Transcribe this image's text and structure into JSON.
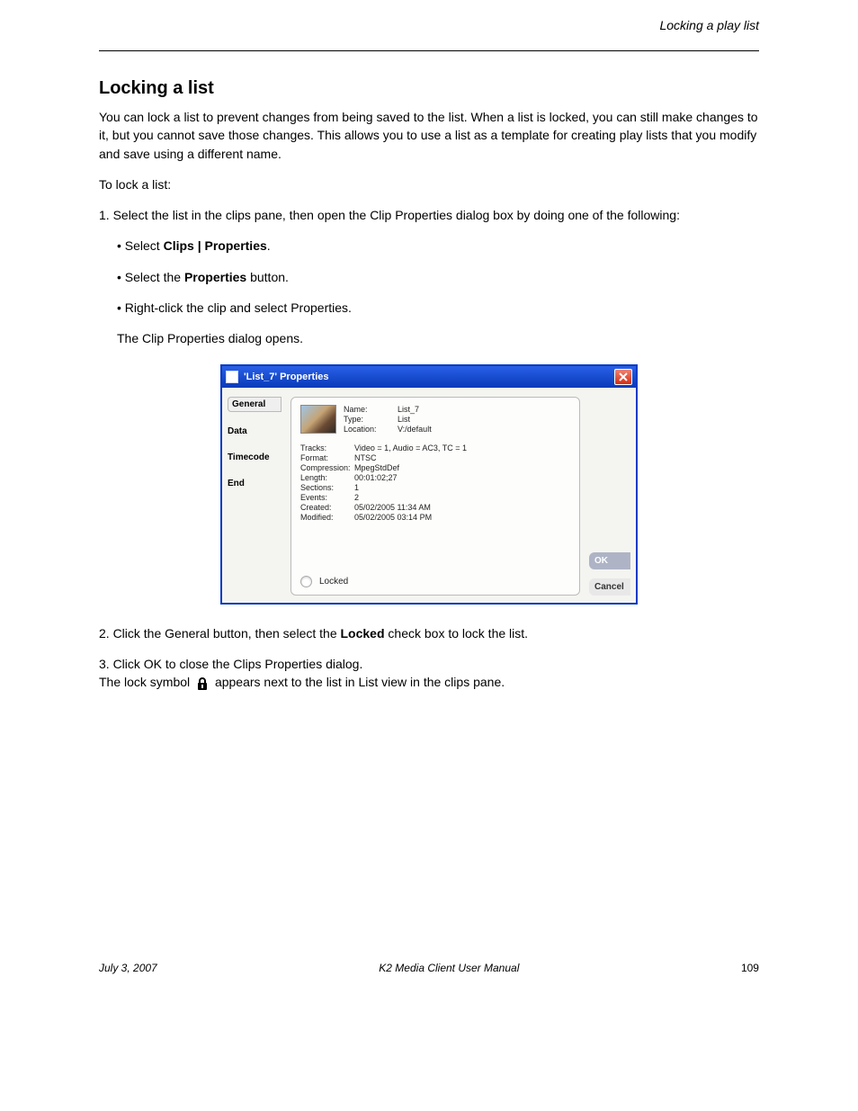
{
  "header": {
    "top_right": "Locking a play list"
  },
  "sections": {
    "title": "Locking a list",
    "p1": "You can lock a list to prevent changes from being saved to the list. When a list is locked, you can still make changes to it, but you cannot save those changes. This allows you to use a list as a template for creating play lists that you modify and save using a different name.",
    "p2": "To lock a list:",
    "step1_a": "1. Select the list in the clips pane, then open the Clip Properties dialog box by doing one of the following:",
    "step1_b1": "• Select ",
    "step1_b2": "Clips | Properties",
    "step1_b3": ".",
    "step1_c1": "• Select the ",
    "step1_c2": "Properties",
    "step1_c3": " button.",
    "step1_d": "• Right-click the clip and select Properties.",
    "step1_e": "The Clip Properties dialog opens.",
    "step2_a": "2. Click the General button, then select the ",
    "step2_b": "Locked",
    "step2_c": " check box to lock the list.",
    "step3": "3. Click OK to close the Clips Properties dialog.",
    "closing_a": "The lock symbol ",
    "closing_b": " appears next to the list in List view in the clips pane."
  },
  "dialog": {
    "title": "'List_7' Properties",
    "nav": {
      "general": "General",
      "data": "Data",
      "timecode": "Timecode",
      "end": "End"
    },
    "rows": {
      "name_k": "Name:",
      "name_v": "List_7",
      "type_k": "Type:",
      "type_v": "List",
      "location_k": "Location:",
      "location_v": "V:/default",
      "tracks_k": "Tracks:",
      "tracks_v": "Video = 1, Audio = AC3, TC = 1",
      "format_k": "Format:",
      "format_v": "NTSC",
      "compression_k": "Compression:",
      "compression_v": "MpegStdDef",
      "length_k": "Length:",
      "length_v": "00:01:02;27",
      "sections_k": "Sections:",
      "sections_v": "1",
      "events_k": "Events:",
      "events_v": "2",
      "created_k": "Created:",
      "created_v": "05/02/2005 11:34 AM",
      "modified_k": "Modified:",
      "modified_v": "05/02/2005 03:14 PM"
    },
    "locked_label": "Locked",
    "ok": "OK",
    "cancel": "Cancel"
  },
  "footer": {
    "date": "July 3, 2007",
    "doc": "K2 Media Client User Manual",
    "page": "109"
  }
}
